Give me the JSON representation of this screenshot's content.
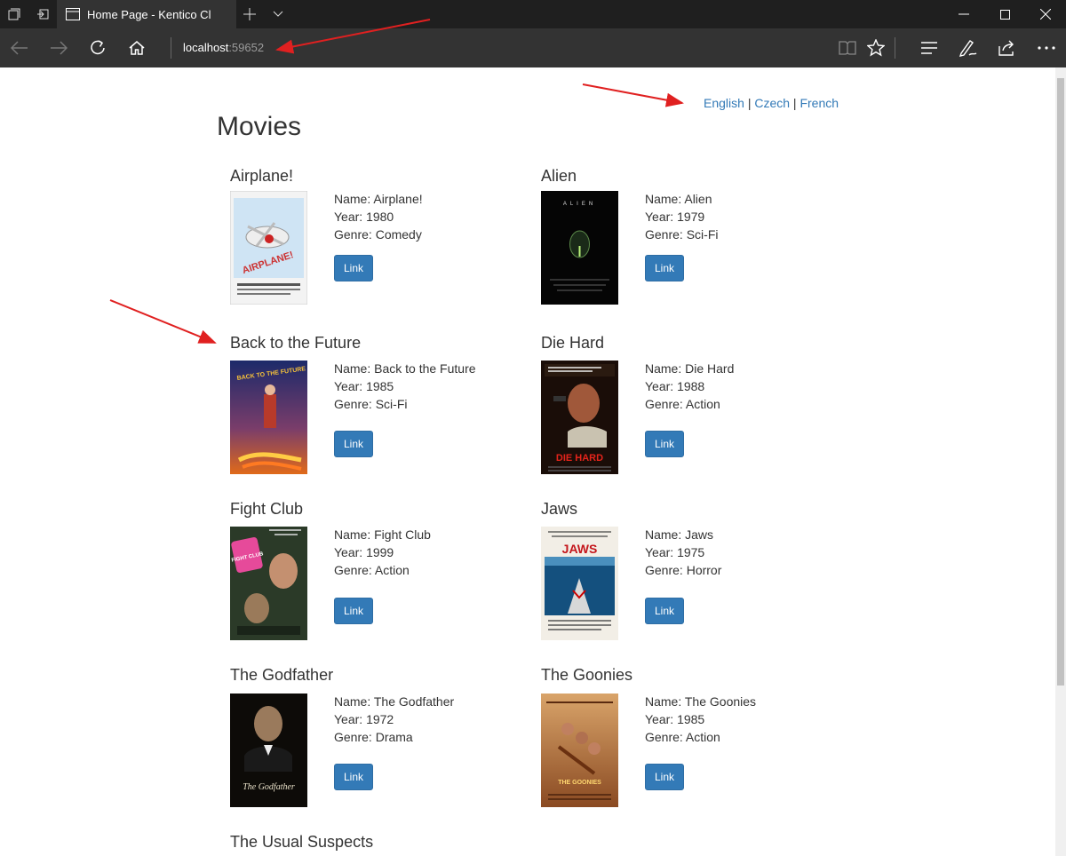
{
  "browser": {
    "tab_title": "Home Page - Kentico Cl",
    "address_host": "localhost",
    "address_port": ":59652"
  },
  "languages": {
    "items": [
      "English",
      "Czech",
      "French"
    ],
    "separator": "|"
  },
  "page": {
    "heading": "Movies",
    "name_label": "Name: ",
    "year_label": "Year: ",
    "genre_label": "Genre: ",
    "link_label": "Link"
  },
  "movies": [
    {
      "title": "Airplane!",
      "name": "Airplane!",
      "year": "1980",
      "genre": "Comedy",
      "poster_text": "AIRPLANE!"
    },
    {
      "title": "Alien",
      "name": "Alien",
      "year": "1979",
      "genre": "Sci-Fi",
      "poster_text": "ALIEN"
    },
    {
      "title": "Back to the Future",
      "name": "Back to the Future",
      "year": "1985",
      "genre": "Sci-Fi",
      "poster_text": "BACK TO THE FUTURE"
    },
    {
      "title": "Die Hard",
      "name": "Die Hard",
      "year": "1988",
      "genre": "Action",
      "poster_text": "DIE HARD"
    },
    {
      "title": "Fight Club",
      "name": "Fight Club",
      "year": "1999",
      "genre": "Action",
      "poster_text": "FIGHT CLUB"
    },
    {
      "title": "Jaws",
      "name": "Jaws",
      "year": "1975",
      "genre": "Horror",
      "poster_text": "JAWS"
    },
    {
      "title": "The Godfather",
      "name": "The Godfather",
      "year": "1972",
      "genre": "Drama",
      "poster_text": "The Godfather"
    },
    {
      "title": "The Goonies",
      "name": "The Goonies",
      "year": "1985",
      "genre": "Action",
      "poster_text": "THE GOONIES"
    },
    {
      "title": "The Usual Suspects"
    }
  ],
  "colors": {
    "link": "#337ab7",
    "button": "#337ab7",
    "annotation_arrow": "#e02020",
    "chrome_dark": "#1f1f1f",
    "chrome": "#333333"
  }
}
